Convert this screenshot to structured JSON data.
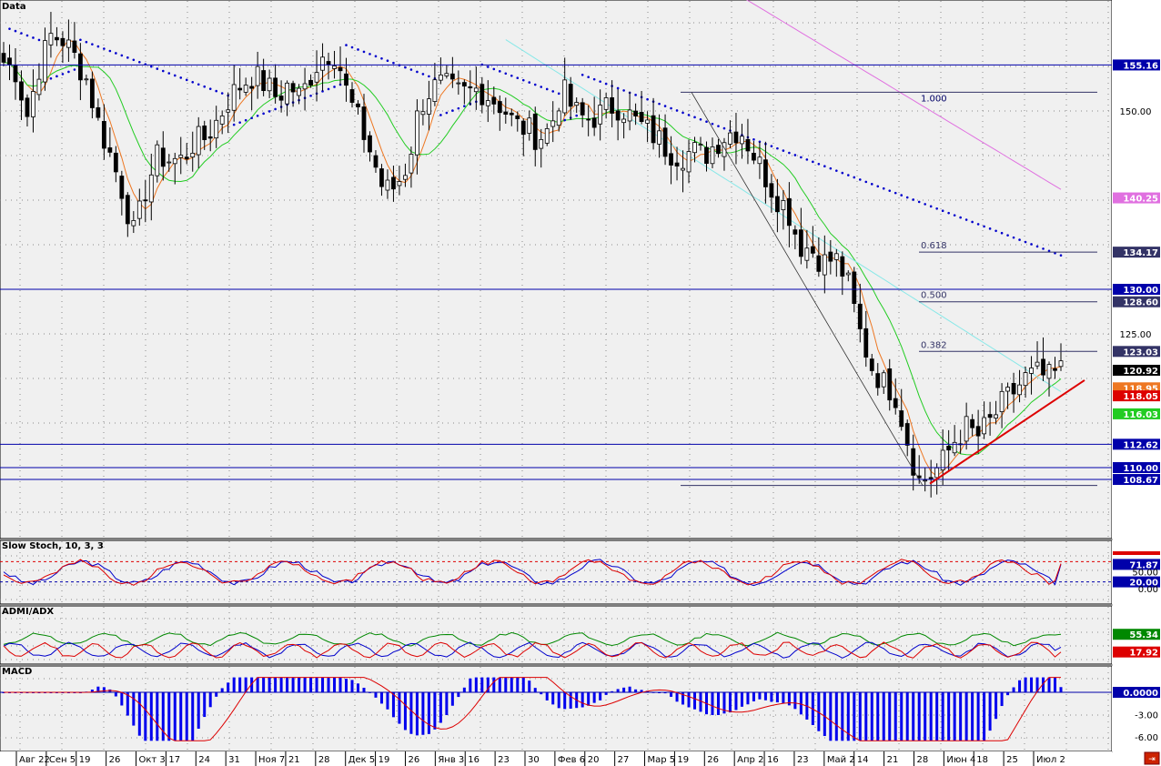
{
  "chart_data": [
    {
      "type": "candlestick",
      "panel": "price",
      "title": "Data",
      "price_axis_ticks": [
        "150.00",
        "125.00"
      ],
      "time_axis_ticks": [
        "Авг 22",
        "Сен 5",
        "19",
        "26",
        "Окт 3",
        "17",
        "24",
        "31",
        "Ноя 7",
        "21",
        "28",
        "Дек 5",
        "19",
        "26",
        "Янв 3",
        "16",
        "23",
        "30",
        "Фев 6",
        "20",
        "27",
        "Мар 5",
        "19",
        "26",
        "Апр 2",
        "16",
        "23",
        "Май 2",
        "14",
        "21",
        "28",
        "Июн 4",
        "18",
        "25",
        "Июл 2"
      ],
      "price_badges": [
        {
          "label": "155.16",
          "value": 155.16,
          "color": "#0000aa"
        },
        {
          "label": "140.25",
          "value": 140.25,
          "color": "#e070e0"
        },
        {
          "label": "134.17",
          "value": 134.17,
          "color": "#333366"
        },
        {
          "label": "130.00",
          "value": 130.0,
          "color": "#0000aa"
        },
        {
          "label": "128.60",
          "value": 128.6,
          "color": "#333366"
        },
        {
          "label": "123.03",
          "value": 123.03,
          "color": "#333366"
        },
        {
          "label": "120.92",
          "value": 120.92,
          "color": "#000000"
        },
        {
          "label": "118.95",
          "value": 118.95,
          "color": "#ee7722"
        },
        {
          "label": "118.05",
          "value": 118.05,
          "color": "#dd0000"
        },
        {
          "label": "116.03",
          "value": 116.03,
          "color": "#22cc22"
        },
        {
          "label": "112.62",
          "value": 112.62,
          "color": "#0000aa"
        },
        {
          "label": "110.00",
          "value": 110.0,
          "color": "#0000aa"
        },
        {
          "label": "108.67",
          "value": 108.67,
          "color": "#0000aa"
        }
      ],
      "horizontal_levels": [
        155.16,
        130.0,
        112.62,
        110.0,
        108.67
      ],
      "fibonacci": {
        "high": 152.1,
        "low": 108.0,
        "levels": [
          {
            "label": "1.000",
            "value": 152.1
          },
          {
            "label": "0.618",
            "value": 134.17
          },
          {
            "label": "0.500",
            "value": 128.6
          },
          {
            "label": "0.382",
            "value": 123.03
          }
        ]
      },
      "ohlc_approx_close": [
        155.5,
        154.5,
        149.5,
        155.0,
        158.5,
        158.0,
        156.0,
        153.5,
        148.5,
        145.0,
        141.0,
        136.0,
        141.5,
        145.0,
        144.5,
        144.5,
        146.5,
        147.0,
        149.0,
        151.5,
        153.0,
        154.0,
        153.0,
        151.5,
        153.0,
        151.5,
        154.5,
        156.5,
        156.5,
        151.5,
        148.5,
        145.0,
        141.0,
        141.5,
        144.0,
        150.5,
        152.5,
        153.0,
        152.0,
        152.0,
        152.5,
        151.5,
        150.5,
        148.5,
        148.0,
        147.0,
        148.0,
        152.5,
        150.0,
        149.0,
        149.5,
        150.5,
        150.5,
        149.0,
        148.0,
        147.0,
        145.5,
        145.0,
        145.5,
        145.0,
        146.5,
        147.5,
        148.0,
        145.5,
        143.0,
        140.5,
        139.0,
        135.0,
        134.5,
        133.0,
        133.5,
        131.0,
        125.5,
        121.5,
        119.5,
        118.5,
        113.5,
        108.5,
        109.0,
        110.5,
        113.0,
        114.5,
        113.5,
        115.0,
        117.0,
        118.5,
        120.0,
        120.5,
        120.0,
        120.92
      ],
      "moving_averages": [
        {
          "name": "",
          "color": "#ee7722",
          "last": 118.95
        },
        {
          "name": "",
          "color": "#22cc22",
          "last": 116.03
        },
        {
          "name": "",
          "color": "#88e8e8",
          "last": 130.0
        },
        {
          "name": "",
          "color": "#e070e0",
          "last": 140.25
        }
      ],
      "parabolic_sar": "dotted",
      "trendline_color": "#dd0000"
    },
    {
      "type": "line",
      "panel": "oscillator",
      "title": "Slow Stoch, 10, 3, 3",
      "ylim": [
        0,
        100
      ],
      "levels": [
        80,
        20
      ],
      "axis_ticks": [
        "50.00",
        "0.00"
      ],
      "badges": [
        {
          "label": "71.87",
          "value": 71.87
        },
        {
          "label": "20.00",
          "value": 20.0
        }
      ],
      "series": [
        {
          "name": "",
          "color": "#0000cc",
          "last": 71.87
        },
        {
          "name": "",
          "color": "#dd0000",
          "last": 74.0
        }
      ]
    },
    {
      "type": "line",
      "panel": "oscillator",
      "title": "ADMI/ADX",
      "badges": [
        {
          "label": "55.34",
          "value": 55.34,
          "color": "#008800"
        },
        {
          "label": "17.92",
          "value": 17.92,
          "color": "#dd0000"
        }
      ],
      "series": [
        {
          "name": "",
          "color": "#008800",
          "last": 55.34
        },
        {
          "name": "",
          "color": "#0000cc",
          "last": 28.0
        },
        {
          "name": "",
          "color": "#dd0000",
          "last": 17.92
        }
      ]
    },
    {
      "type": "bar",
      "panel": "oscillator",
      "title": "MACD",
      "axis_ticks": [
        "-3.00",
        "-6.00"
      ],
      "badges": [
        {
          "label": "0.0000",
          "value": 0.0
        }
      ],
      "histogram_color": "#0000ee",
      "signal_color": "#dd0000"
    }
  ],
  "colors": {
    "bg": "#f0f0f0",
    "up_candle": "#ffffff",
    "down_candle": "#000000",
    "level_line": "#0000aa",
    "fib_line": "#333366",
    "sar": "#0000cc",
    "stoch_level": "#dd0000",
    "axis_text": "#000000"
  },
  "icons": {
    "corner_button": "exit-icon"
  }
}
